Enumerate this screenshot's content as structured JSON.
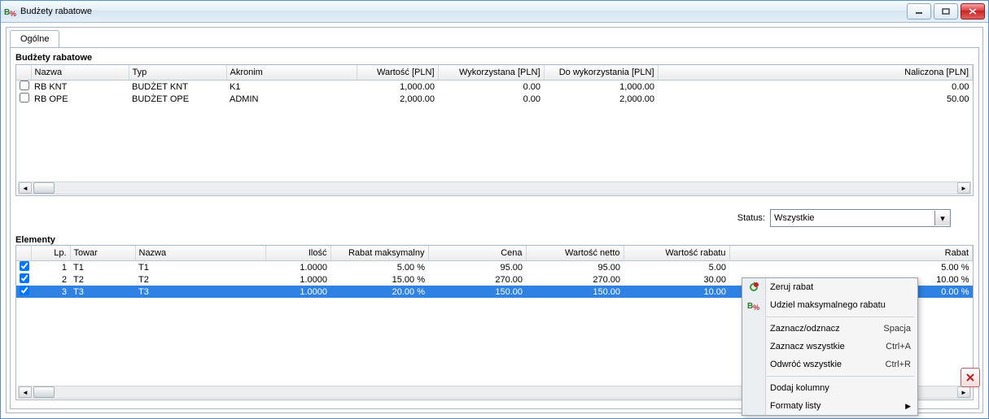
{
  "window": {
    "title": "Budżety rabatowe"
  },
  "tabs": {
    "general": "Ogólne"
  },
  "budgets": {
    "title": "Budżety rabatowe",
    "cols": {
      "name": "Nazwa",
      "type": "Typ",
      "acronym": "Akronim",
      "value": "Wartość [PLN]",
      "used": "Wykorzystana [PLN]",
      "available": "Do wykorzystania [PLN]",
      "accrued": "Naliczona [PLN]"
    },
    "rows": [
      {
        "name": "RB KNT",
        "type": "BUDŻET KNT",
        "acronym": "K1",
        "value": "1,000.00",
        "used": "0.00",
        "available": "1,000.00",
        "accrued": "0.00"
      },
      {
        "name": "RB OPE",
        "type": "BUDŻET OPE",
        "acronym": "ADMIN",
        "value": "2,000.00",
        "used": "0.00",
        "available": "2,000.00",
        "accrued": "50.00"
      }
    ]
  },
  "status": {
    "label": "Status:",
    "value": "Wszystkie"
  },
  "elements": {
    "title": "Elementy",
    "cols": {
      "lp": "Lp.",
      "towar": "Towar",
      "name": "Nazwa",
      "qty": "Ilość",
      "rmax": "Rabat maksymalny",
      "price": "Cena",
      "net": "Wartość netto",
      "rval": "Wartość rabatu",
      "rpct": "Rabat"
    },
    "rows": [
      {
        "checked": true,
        "selected": false,
        "lp": "1",
        "towar": "T1",
        "name": "T1",
        "qty": "1.0000",
        "rmax": "5.00 %",
        "price": "95.00",
        "net": "95.00",
        "rval": "5.00",
        "rpct": "5.00 %"
      },
      {
        "checked": true,
        "selected": false,
        "lp": "2",
        "towar": "T2",
        "name": "T2",
        "qty": "1.0000",
        "rmax": "15.00 %",
        "price": "270.00",
        "net": "270.00",
        "rval": "30.00",
        "rpct": "10.00 %"
      },
      {
        "checked": true,
        "selected": true,
        "lp": "3",
        "towar": "T3",
        "name": "T3",
        "qty": "1.0000",
        "rmax": "20.00 %",
        "price": "150.00",
        "net": "150.00",
        "rval": "10.00",
        "rpct": "0.00 %"
      }
    ]
  },
  "menu": {
    "reset": "Zeruj rabat",
    "grant": "Udziel maksymalnego rabatu",
    "toggle": "Zaznacz/odznacz",
    "toggle_key": "Spacja",
    "select_all": "Zaznacz wszystkie",
    "select_all_key": "Ctrl+A",
    "invert": "Odwróć wszystkie",
    "invert_key": "Ctrl+R",
    "add_cols": "Dodaj kolumny",
    "formats": "Formaty listy"
  }
}
